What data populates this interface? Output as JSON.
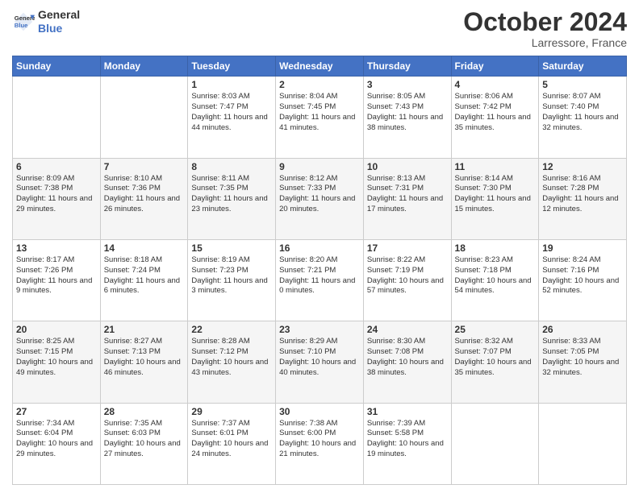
{
  "header": {
    "logo_line1": "General",
    "logo_line2": "Blue",
    "month": "October 2024",
    "location": "Larressore, France"
  },
  "weekdays": [
    "Sunday",
    "Monday",
    "Tuesday",
    "Wednesday",
    "Thursday",
    "Friday",
    "Saturday"
  ],
  "weeks": [
    [
      {
        "day": "",
        "sunrise": "",
        "sunset": "",
        "daylight": ""
      },
      {
        "day": "",
        "sunrise": "",
        "sunset": "",
        "daylight": ""
      },
      {
        "day": "1",
        "sunrise": "Sunrise: 8:03 AM",
        "sunset": "Sunset: 7:47 PM",
        "daylight": "Daylight: 11 hours and 44 minutes."
      },
      {
        "day": "2",
        "sunrise": "Sunrise: 8:04 AM",
        "sunset": "Sunset: 7:45 PM",
        "daylight": "Daylight: 11 hours and 41 minutes."
      },
      {
        "day": "3",
        "sunrise": "Sunrise: 8:05 AM",
        "sunset": "Sunset: 7:43 PM",
        "daylight": "Daylight: 11 hours and 38 minutes."
      },
      {
        "day": "4",
        "sunrise": "Sunrise: 8:06 AM",
        "sunset": "Sunset: 7:42 PM",
        "daylight": "Daylight: 11 hours and 35 minutes."
      },
      {
        "day": "5",
        "sunrise": "Sunrise: 8:07 AM",
        "sunset": "Sunset: 7:40 PM",
        "daylight": "Daylight: 11 hours and 32 minutes."
      }
    ],
    [
      {
        "day": "6",
        "sunrise": "Sunrise: 8:09 AM",
        "sunset": "Sunset: 7:38 PM",
        "daylight": "Daylight: 11 hours and 29 minutes."
      },
      {
        "day": "7",
        "sunrise": "Sunrise: 8:10 AM",
        "sunset": "Sunset: 7:36 PM",
        "daylight": "Daylight: 11 hours and 26 minutes."
      },
      {
        "day": "8",
        "sunrise": "Sunrise: 8:11 AM",
        "sunset": "Sunset: 7:35 PM",
        "daylight": "Daylight: 11 hours and 23 minutes."
      },
      {
        "day": "9",
        "sunrise": "Sunrise: 8:12 AM",
        "sunset": "Sunset: 7:33 PM",
        "daylight": "Daylight: 11 hours and 20 minutes."
      },
      {
        "day": "10",
        "sunrise": "Sunrise: 8:13 AM",
        "sunset": "Sunset: 7:31 PM",
        "daylight": "Daylight: 11 hours and 17 minutes."
      },
      {
        "day": "11",
        "sunrise": "Sunrise: 8:14 AM",
        "sunset": "Sunset: 7:30 PM",
        "daylight": "Daylight: 11 hours and 15 minutes."
      },
      {
        "day": "12",
        "sunrise": "Sunrise: 8:16 AM",
        "sunset": "Sunset: 7:28 PM",
        "daylight": "Daylight: 11 hours and 12 minutes."
      }
    ],
    [
      {
        "day": "13",
        "sunrise": "Sunrise: 8:17 AM",
        "sunset": "Sunset: 7:26 PM",
        "daylight": "Daylight: 11 hours and 9 minutes."
      },
      {
        "day": "14",
        "sunrise": "Sunrise: 8:18 AM",
        "sunset": "Sunset: 7:24 PM",
        "daylight": "Daylight: 11 hours and 6 minutes."
      },
      {
        "day": "15",
        "sunrise": "Sunrise: 8:19 AM",
        "sunset": "Sunset: 7:23 PM",
        "daylight": "Daylight: 11 hours and 3 minutes."
      },
      {
        "day": "16",
        "sunrise": "Sunrise: 8:20 AM",
        "sunset": "Sunset: 7:21 PM",
        "daylight": "Daylight: 11 hours and 0 minutes."
      },
      {
        "day": "17",
        "sunrise": "Sunrise: 8:22 AM",
        "sunset": "Sunset: 7:19 PM",
        "daylight": "Daylight: 10 hours and 57 minutes."
      },
      {
        "day": "18",
        "sunrise": "Sunrise: 8:23 AM",
        "sunset": "Sunset: 7:18 PM",
        "daylight": "Daylight: 10 hours and 54 minutes."
      },
      {
        "day": "19",
        "sunrise": "Sunrise: 8:24 AM",
        "sunset": "Sunset: 7:16 PM",
        "daylight": "Daylight: 10 hours and 52 minutes."
      }
    ],
    [
      {
        "day": "20",
        "sunrise": "Sunrise: 8:25 AM",
        "sunset": "Sunset: 7:15 PM",
        "daylight": "Daylight: 10 hours and 49 minutes."
      },
      {
        "day": "21",
        "sunrise": "Sunrise: 8:27 AM",
        "sunset": "Sunset: 7:13 PM",
        "daylight": "Daylight: 10 hours and 46 minutes."
      },
      {
        "day": "22",
        "sunrise": "Sunrise: 8:28 AM",
        "sunset": "Sunset: 7:12 PM",
        "daylight": "Daylight: 10 hours and 43 minutes."
      },
      {
        "day": "23",
        "sunrise": "Sunrise: 8:29 AM",
        "sunset": "Sunset: 7:10 PM",
        "daylight": "Daylight: 10 hours and 40 minutes."
      },
      {
        "day": "24",
        "sunrise": "Sunrise: 8:30 AM",
        "sunset": "Sunset: 7:08 PM",
        "daylight": "Daylight: 10 hours and 38 minutes."
      },
      {
        "day": "25",
        "sunrise": "Sunrise: 8:32 AM",
        "sunset": "Sunset: 7:07 PM",
        "daylight": "Daylight: 10 hours and 35 minutes."
      },
      {
        "day": "26",
        "sunrise": "Sunrise: 8:33 AM",
        "sunset": "Sunset: 7:05 PM",
        "daylight": "Daylight: 10 hours and 32 minutes."
      }
    ],
    [
      {
        "day": "27",
        "sunrise": "Sunrise: 7:34 AM",
        "sunset": "Sunset: 6:04 PM",
        "daylight": "Daylight: 10 hours and 29 minutes."
      },
      {
        "day": "28",
        "sunrise": "Sunrise: 7:35 AM",
        "sunset": "Sunset: 6:03 PM",
        "daylight": "Daylight: 10 hours and 27 minutes."
      },
      {
        "day": "29",
        "sunrise": "Sunrise: 7:37 AM",
        "sunset": "Sunset: 6:01 PM",
        "daylight": "Daylight: 10 hours and 24 minutes."
      },
      {
        "day": "30",
        "sunrise": "Sunrise: 7:38 AM",
        "sunset": "Sunset: 6:00 PM",
        "daylight": "Daylight: 10 hours and 21 minutes."
      },
      {
        "day": "31",
        "sunrise": "Sunrise: 7:39 AM",
        "sunset": "Sunset: 5:58 PM",
        "daylight": "Daylight: 10 hours and 19 minutes."
      },
      {
        "day": "",
        "sunrise": "",
        "sunset": "",
        "daylight": ""
      },
      {
        "day": "",
        "sunrise": "",
        "sunset": "",
        "daylight": ""
      }
    ]
  ]
}
